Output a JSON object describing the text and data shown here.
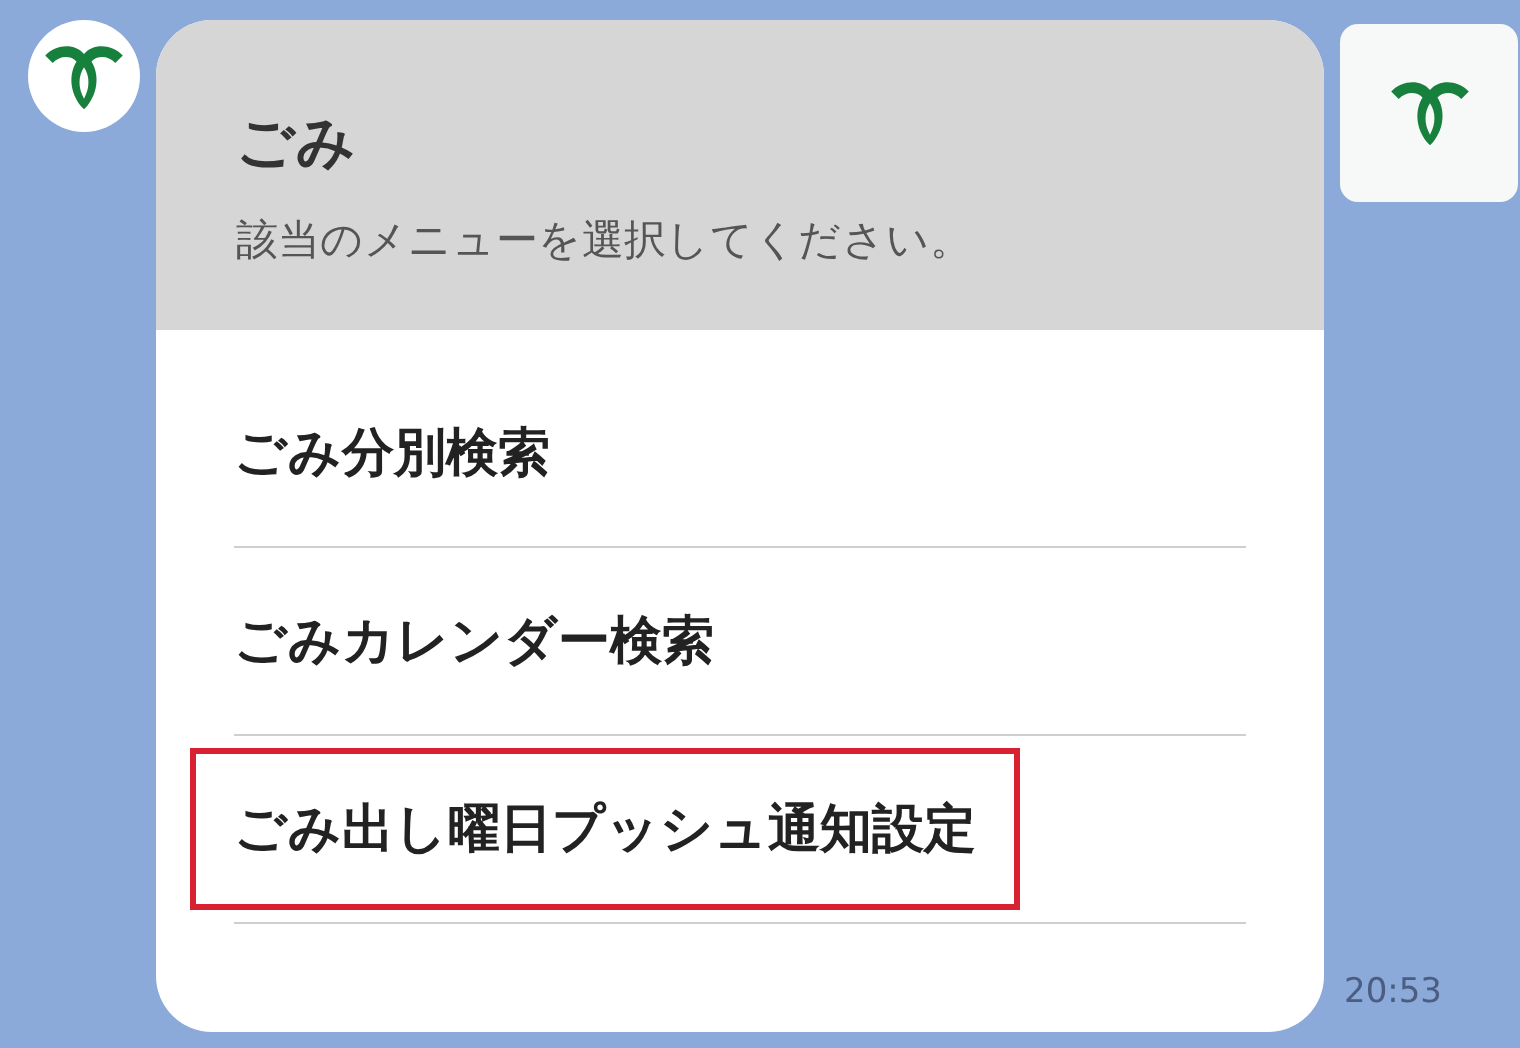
{
  "header": {
    "title": "ごみ",
    "subtitle": "該当のメニューを選択してください。"
  },
  "menu_items": [
    {
      "label": "ごみ分別検索",
      "highlighted": false
    },
    {
      "label": "ごみカレンダー検索",
      "highlighted": false
    },
    {
      "label": "ごみ出し曜日プッシュ通知設定",
      "highlighted": true
    }
  ],
  "timestamp": "20:53"
}
